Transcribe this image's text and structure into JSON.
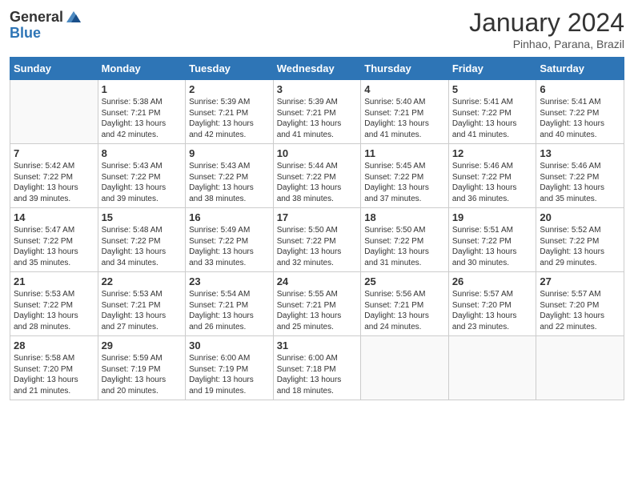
{
  "header": {
    "logo_general": "General",
    "logo_blue": "Blue",
    "month_year": "January 2024",
    "location": "Pinhao, Parana, Brazil"
  },
  "weekdays": [
    "Sunday",
    "Monday",
    "Tuesday",
    "Wednesday",
    "Thursday",
    "Friday",
    "Saturday"
  ],
  "weeks": [
    [
      {
        "day": "",
        "sunrise": "",
        "sunset": "",
        "daylight": ""
      },
      {
        "day": "1",
        "sunrise": "Sunrise: 5:38 AM",
        "sunset": "Sunset: 7:21 PM",
        "daylight": "Daylight: 13 hours and 42 minutes."
      },
      {
        "day": "2",
        "sunrise": "Sunrise: 5:39 AM",
        "sunset": "Sunset: 7:21 PM",
        "daylight": "Daylight: 13 hours and 42 minutes."
      },
      {
        "day": "3",
        "sunrise": "Sunrise: 5:39 AM",
        "sunset": "Sunset: 7:21 PM",
        "daylight": "Daylight: 13 hours and 41 minutes."
      },
      {
        "day": "4",
        "sunrise": "Sunrise: 5:40 AM",
        "sunset": "Sunset: 7:21 PM",
        "daylight": "Daylight: 13 hours and 41 minutes."
      },
      {
        "day": "5",
        "sunrise": "Sunrise: 5:41 AM",
        "sunset": "Sunset: 7:22 PM",
        "daylight": "Daylight: 13 hours and 41 minutes."
      },
      {
        "day": "6",
        "sunrise": "Sunrise: 5:41 AM",
        "sunset": "Sunset: 7:22 PM",
        "daylight": "Daylight: 13 hours and 40 minutes."
      }
    ],
    [
      {
        "day": "7",
        "sunrise": "Sunrise: 5:42 AM",
        "sunset": "Sunset: 7:22 PM",
        "daylight": "Daylight: 13 hours and 39 minutes."
      },
      {
        "day": "8",
        "sunrise": "Sunrise: 5:43 AM",
        "sunset": "Sunset: 7:22 PM",
        "daylight": "Daylight: 13 hours and 39 minutes."
      },
      {
        "day": "9",
        "sunrise": "Sunrise: 5:43 AM",
        "sunset": "Sunset: 7:22 PM",
        "daylight": "Daylight: 13 hours and 38 minutes."
      },
      {
        "day": "10",
        "sunrise": "Sunrise: 5:44 AM",
        "sunset": "Sunset: 7:22 PM",
        "daylight": "Daylight: 13 hours and 38 minutes."
      },
      {
        "day": "11",
        "sunrise": "Sunrise: 5:45 AM",
        "sunset": "Sunset: 7:22 PM",
        "daylight": "Daylight: 13 hours and 37 minutes."
      },
      {
        "day": "12",
        "sunrise": "Sunrise: 5:46 AM",
        "sunset": "Sunset: 7:22 PM",
        "daylight": "Daylight: 13 hours and 36 minutes."
      },
      {
        "day": "13",
        "sunrise": "Sunrise: 5:46 AM",
        "sunset": "Sunset: 7:22 PM",
        "daylight": "Daylight: 13 hours and 35 minutes."
      }
    ],
    [
      {
        "day": "14",
        "sunrise": "Sunrise: 5:47 AM",
        "sunset": "Sunset: 7:22 PM",
        "daylight": "Daylight: 13 hours and 35 minutes."
      },
      {
        "day": "15",
        "sunrise": "Sunrise: 5:48 AM",
        "sunset": "Sunset: 7:22 PM",
        "daylight": "Daylight: 13 hours and 34 minutes."
      },
      {
        "day": "16",
        "sunrise": "Sunrise: 5:49 AM",
        "sunset": "Sunset: 7:22 PM",
        "daylight": "Daylight: 13 hours and 33 minutes."
      },
      {
        "day": "17",
        "sunrise": "Sunrise: 5:50 AM",
        "sunset": "Sunset: 7:22 PM",
        "daylight": "Daylight: 13 hours and 32 minutes."
      },
      {
        "day": "18",
        "sunrise": "Sunrise: 5:50 AM",
        "sunset": "Sunset: 7:22 PM",
        "daylight": "Daylight: 13 hours and 31 minutes."
      },
      {
        "day": "19",
        "sunrise": "Sunrise: 5:51 AM",
        "sunset": "Sunset: 7:22 PM",
        "daylight": "Daylight: 13 hours and 30 minutes."
      },
      {
        "day": "20",
        "sunrise": "Sunrise: 5:52 AM",
        "sunset": "Sunset: 7:22 PM",
        "daylight": "Daylight: 13 hours and 29 minutes."
      }
    ],
    [
      {
        "day": "21",
        "sunrise": "Sunrise: 5:53 AM",
        "sunset": "Sunset: 7:22 PM",
        "daylight": "Daylight: 13 hours and 28 minutes."
      },
      {
        "day": "22",
        "sunrise": "Sunrise: 5:53 AM",
        "sunset": "Sunset: 7:21 PM",
        "daylight": "Daylight: 13 hours and 27 minutes."
      },
      {
        "day": "23",
        "sunrise": "Sunrise: 5:54 AM",
        "sunset": "Sunset: 7:21 PM",
        "daylight": "Daylight: 13 hours and 26 minutes."
      },
      {
        "day": "24",
        "sunrise": "Sunrise: 5:55 AM",
        "sunset": "Sunset: 7:21 PM",
        "daylight": "Daylight: 13 hours and 25 minutes."
      },
      {
        "day": "25",
        "sunrise": "Sunrise: 5:56 AM",
        "sunset": "Sunset: 7:21 PM",
        "daylight": "Daylight: 13 hours and 24 minutes."
      },
      {
        "day": "26",
        "sunrise": "Sunrise: 5:57 AM",
        "sunset": "Sunset: 7:20 PM",
        "daylight": "Daylight: 13 hours and 23 minutes."
      },
      {
        "day": "27",
        "sunrise": "Sunrise: 5:57 AM",
        "sunset": "Sunset: 7:20 PM",
        "daylight": "Daylight: 13 hours and 22 minutes."
      }
    ],
    [
      {
        "day": "28",
        "sunrise": "Sunrise: 5:58 AM",
        "sunset": "Sunset: 7:20 PM",
        "daylight": "Daylight: 13 hours and 21 minutes."
      },
      {
        "day": "29",
        "sunrise": "Sunrise: 5:59 AM",
        "sunset": "Sunset: 7:19 PM",
        "daylight": "Daylight: 13 hours and 20 minutes."
      },
      {
        "day": "30",
        "sunrise": "Sunrise: 6:00 AM",
        "sunset": "Sunset: 7:19 PM",
        "daylight": "Daylight: 13 hours and 19 minutes."
      },
      {
        "day": "31",
        "sunrise": "Sunrise: 6:00 AM",
        "sunset": "Sunset: 7:18 PM",
        "daylight": "Daylight: 13 hours and 18 minutes."
      },
      {
        "day": "",
        "sunrise": "",
        "sunset": "",
        "daylight": ""
      },
      {
        "day": "",
        "sunrise": "",
        "sunset": "",
        "daylight": ""
      },
      {
        "day": "",
        "sunrise": "",
        "sunset": "",
        "daylight": ""
      }
    ]
  ]
}
